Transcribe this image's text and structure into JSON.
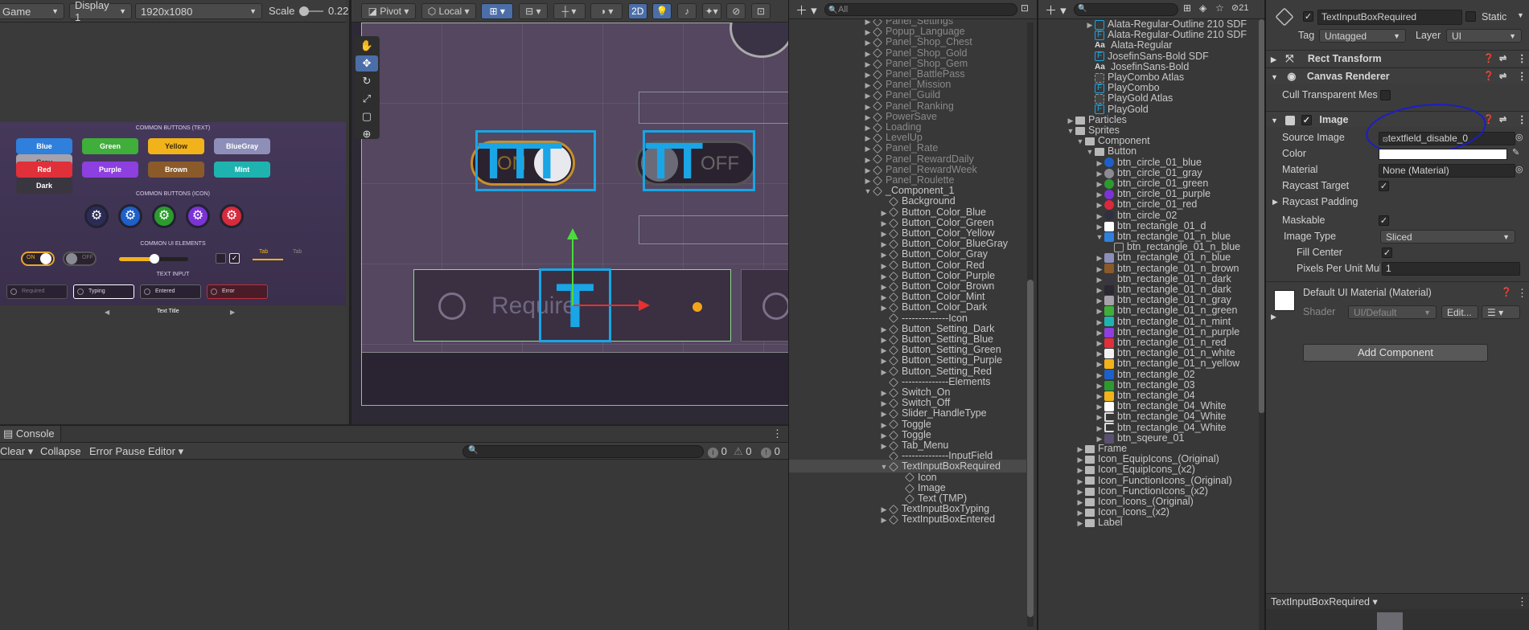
{
  "game_toolbar": {
    "game_label": "Game",
    "display": "Display 1",
    "resolution": "1920x1080",
    "scale_label": "Scale",
    "scale_value": "0.22"
  },
  "scene_toolbar": {
    "pivot": "Pivot",
    "local": "Local",
    "mode_2d": "2D"
  },
  "game_preview": {
    "section_text": "COMMON BUTTONS (TEXT)",
    "buttons_row1": [
      "Blue",
      "Green",
      "Yellow",
      "BlueGray",
      "Gray"
    ],
    "buttons_row2": [
      "Red",
      "Purple",
      "Brown",
      "Mint",
      "Dark"
    ],
    "section_icon": "COMMON BUTTONS (ICON)",
    "section_ui": "COMMON UI ELEMENTS",
    "switch_on": "ON",
    "switch_off": "OFF",
    "tab1": "Tab",
    "tab2": "Tab",
    "section_input": "TEXT INPUT",
    "inputs": [
      "Required",
      "Typing",
      "Entered",
      "Error"
    ],
    "text_title": "Text Title",
    "colors": {
      "Blue": "#2f7fdc",
      "Green": "#3fae3a",
      "Yellow": "#f2b21a",
      "BlueGray": "#8d8fb8",
      "Gray": "#a6a1ab",
      "Red": "#e0303a",
      "Purple": "#8d3fe0",
      "Brown": "#8a5a2a",
      "Mint": "#1fb3b0",
      "Dark": "#3a3640"
    },
    "gear_colors": [
      "#2b2b55",
      "#1f5fc8",
      "#2c9b2e",
      "#7b33d6",
      "#d82a3c"
    ]
  },
  "scene_view": {
    "placeholder_text": "Require",
    "on_label": "ON",
    "off_label": "OFF"
  },
  "console": {
    "tab": "Console",
    "clear": "Clear",
    "collapse": "Collapse",
    "error_pause": "Error Pause",
    "editor": "Editor",
    "count_log": "0",
    "count_warn": "0",
    "count_error": "0"
  },
  "hierarchy": {
    "search_placeholder": "All",
    "items": [
      {
        "label": "Panel_Settings",
        "indent": 0,
        "fold": "▶",
        "dim": true
      },
      {
        "label": "Popup_Language",
        "indent": 0,
        "fold": "▶",
        "dim": true
      },
      {
        "label": "Panel_Shop_Chest",
        "indent": 0,
        "fold": "▶",
        "dim": true
      },
      {
        "label": "Panel_Shop_Gold",
        "indent": 0,
        "fold": "▶",
        "dim": true
      },
      {
        "label": "Panel_Shop_Gem",
        "indent": 0,
        "fold": "▶",
        "dim": true
      },
      {
        "label": "Panel_BattlePass",
        "indent": 0,
        "fold": "▶",
        "dim": true
      },
      {
        "label": "Panel_Mission",
        "indent": 0,
        "fold": "▶",
        "dim": true
      },
      {
        "label": "Panel_Guild",
        "indent": 0,
        "fold": "▶",
        "dim": true
      },
      {
        "label": "Panel_Ranking",
        "indent": 0,
        "fold": "▶",
        "dim": true
      },
      {
        "label": "PowerSave",
        "indent": 0,
        "fold": "▶",
        "dim": true
      },
      {
        "label": "Loading",
        "indent": 0,
        "fold": "▶",
        "dim": true
      },
      {
        "label": "LevelUp",
        "indent": 0,
        "fold": "▶",
        "dim": true
      },
      {
        "label": "Panel_Rate",
        "indent": 0,
        "fold": "▶",
        "dim": true
      },
      {
        "label": "Panel_RewardDaily",
        "indent": 0,
        "fold": "▶",
        "dim": true
      },
      {
        "label": "Panel_RewardWeek",
        "indent": 0,
        "fold": "▶",
        "dim": true
      },
      {
        "label": "Panel_Roulette",
        "indent": 0,
        "fold": "▶",
        "dim": true
      },
      {
        "label": "_Component_1",
        "indent": 0,
        "fold": "▼",
        "dim": false
      },
      {
        "label": "Background",
        "indent": 1,
        "fold": "",
        "dim": false
      },
      {
        "label": "Button_Color_Blue",
        "indent": 1,
        "fold": "▶",
        "dim": false
      },
      {
        "label": "Button_Color_Green",
        "indent": 1,
        "fold": "▶",
        "dim": false
      },
      {
        "label": "Button_Color_Yellow",
        "indent": 1,
        "fold": "▶",
        "dim": false
      },
      {
        "label": "Button_Color_BlueGray",
        "indent": 1,
        "fold": "▶",
        "dim": false
      },
      {
        "label": "Button_Color_Gray",
        "indent": 1,
        "fold": "▶",
        "dim": false
      },
      {
        "label": "Button_Color_Red",
        "indent": 1,
        "fold": "▶",
        "dim": false
      },
      {
        "label": "Button_Color_Purple",
        "indent": 1,
        "fold": "▶",
        "dim": false
      },
      {
        "label": "Button_Color_Brown",
        "indent": 1,
        "fold": "▶",
        "dim": false
      },
      {
        "label": "Button_Color_Mint",
        "indent": 1,
        "fold": "▶",
        "dim": false
      },
      {
        "label": "Button_Color_Dark",
        "indent": 1,
        "fold": "▶",
        "dim": false
      },
      {
        "label": "--------------Icon",
        "indent": 1,
        "fold": "",
        "dim": false
      },
      {
        "label": "Button_Setting_Dark",
        "indent": 1,
        "fold": "▶",
        "dim": false
      },
      {
        "label": "Button_Setting_Blue",
        "indent": 1,
        "fold": "▶",
        "dim": false
      },
      {
        "label": "Button_Setting_Green",
        "indent": 1,
        "fold": "▶",
        "dim": false
      },
      {
        "label": "Button_Setting_Purple",
        "indent": 1,
        "fold": "▶",
        "dim": false
      },
      {
        "label": "Button_Setting_Red",
        "indent": 1,
        "fold": "▶",
        "dim": false
      },
      {
        "label": "--------------Elements",
        "indent": 1,
        "fold": "",
        "dim": false
      },
      {
        "label": "Switch_On",
        "indent": 1,
        "fold": "▶",
        "dim": false
      },
      {
        "label": "Switch_Off",
        "indent": 1,
        "fold": "▶",
        "dim": false
      },
      {
        "label": "Slider_HandleType",
        "indent": 1,
        "fold": "▶",
        "dim": false
      },
      {
        "label": "Toggle",
        "indent": 1,
        "fold": "▶",
        "dim": false
      },
      {
        "label": "Toggle",
        "indent": 1,
        "fold": "▶",
        "dim": false
      },
      {
        "label": "Tab_Menu",
        "indent": 1,
        "fold": "▶",
        "dim": false
      },
      {
        "label": "--------------InputField",
        "indent": 1,
        "fold": "",
        "dim": false
      },
      {
        "label": "TextInputBoxRequired",
        "indent": 1,
        "fold": "▼",
        "dim": false,
        "sel": true
      },
      {
        "label": "Icon",
        "indent": 2,
        "fold": "",
        "dim": false
      },
      {
        "label": "Image",
        "indent": 2,
        "fold": "",
        "dim": false
      },
      {
        "label": "Text (TMP)",
        "indent": 2,
        "fold": "",
        "dim": false
      },
      {
        "label": "TextInputBoxTyping",
        "indent": 1,
        "fold": "▶",
        "dim": false
      },
      {
        "label": "TextInputBoxEntered",
        "indent": 1,
        "fold": "▶",
        "dim": false
      }
    ]
  },
  "project": {
    "count": "21",
    "items": [
      {
        "label": "Alata-Regular-Outline 210 SDF",
        "indent": 2,
        "icon": "font",
        "fold": "▶"
      },
      {
        "label": "Alata-Regular-Outline 210 SDF",
        "indent": 2,
        "icon": "F",
        "fold": ""
      },
      {
        "label": "Alata-Regular",
        "indent": 2,
        "icon": "Aa",
        "fold": ""
      },
      {
        "label": "JosefinSans-Bold SDF",
        "indent": 2,
        "icon": "F",
        "fold": ""
      },
      {
        "label": "JosefinSans-Bold",
        "indent": 2,
        "icon": "Aa",
        "fold": ""
      },
      {
        "label": "PlayCombo Atlas",
        "indent": 2,
        "icon": "atlas",
        "fold": ""
      },
      {
        "label": "PlayCombo",
        "indent": 2,
        "icon": "F",
        "fold": ""
      },
      {
        "label": "PlayGold Atlas",
        "indent": 2,
        "icon": "atlas",
        "fold": ""
      },
      {
        "label": "PlayGold",
        "indent": 2,
        "icon": "F",
        "fold": ""
      },
      {
        "label": "Particles",
        "indent": 0,
        "icon": "folder",
        "fold": "▶"
      },
      {
        "label": "Sprites",
        "indent": 0,
        "icon": "folder",
        "fold": "▼"
      },
      {
        "label": "Component",
        "indent": 1,
        "icon": "folder",
        "fold": "▼"
      },
      {
        "label": "Button",
        "indent": 2,
        "icon": "folder",
        "fold": "▼"
      },
      {
        "label": "btn_circle_01_blue",
        "indent": 3,
        "icon": "#1f5fc8",
        "fold": "▶"
      },
      {
        "label": "btn_circle_01_gray",
        "indent": 3,
        "icon": "#8b8b95",
        "fold": "▶"
      },
      {
        "label": "btn_circle_01_green",
        "indent": 3,
        "icon": "#2c9b2e",
        "fold": "▶"
      },
      {
        "label": "btn_circle_01_purple",
        "indent": 3,
        "icon": "#7b33d6",
        "fold": "▶"
      },
      {
        "label": "btn_circle_01_red",
        "indent": 3,
        "icon": "#d82a3c",
        "fold": "▶"
      },
      {
        "label": "btn_circle_02",
        "indent": 3,
        "icon": "#303040",
        "fold": "▶"
      },
      {
        "label": "btn_rectangle_01_d",
        "indent": 3,
        "icon": "#ffffff",
        "fold": "▶"
      },
      {
        "label": "btn_rectangle_01_n_blue",
        "indent": 3,
        "icon": "#2f7fdc",
        "fold": "▼"
      },
      {
        "label": "btn_rectangle_01_n_blue",
        "indent": 4,
        "icon": "sprite",
        "fold": ""
      },
      {
        "label": "btn_rectangle_01_n_blue",
        "indent": 3,
        "icon": "#8d8fb8",
        "fold": "▶"
      },
      {
        "label": "btn_rectangle_01_n_brown",
        "indent": 3,
        "icon": "#8a5a2a",
        "fold": "▶"
      },
      {
        "label": "btn_rectangle_01_n_dark",
        "indent": 3,
        "icon": "#3a3640",
        "fold": "▶"
      },
      {
        "label": "btn_rectangle_01_n_dark",
        "indent": 3,
        "icon": "#2a2830",
        "fold": "▶"
      },
      {
        "label": "btn_rectangle_01_n_gray",
        "indent": 3,
        "icon": "#a6a1ab",
        "fold": "▶"
      },
      {
        "label": "btn_rectangle_01_n_green",
        "indent": 3,
        "icon": "#3fae3a",
        "fold": "▶"
      },
      {
        "label": "btn_rectangle_01_n_mint",
        "indent": 3,
        "icon": "#1fb3b0",
        "fold": "▶"
      },
      {
        "label": "btn_rectangle_01_n_purple",
        "indent": 3,
        "icon": "#8d3fe0",
        "fold": "▶"
      },
      {
        "label": "btn_rectangle_01_n_red",
        "indent": 3,
        "icon": "#e0303a",
        "fold": "▶"
      },
      {
        "label": "btn_rectangle_01_n_white",
        "indent": 3,
        "icon": "#f2f2f2",
        "fold": "▶"
      },
      {
        "label": "btn_rectangle_01_n_yellow",
        "indent": 3,
        "icon": "#f2b21a",
        "fold": "▶"
      },
      {
        "label": "btn_rectangle_02",
        "indent": 3,
        "icon": "#1f5fc8",
        "fold": "▶"
      },
      {
        "label": "btn_rectangle_03",
        "indent": 3,
        "icon": "#2c9b2e",
        "fold": "▶"
      },
      {
        "label": "btn_rectangle_04",
        "indent": 3,
        "icon": "#f2b21a",
        "fold": "▶"
      },
      {
        "label": "btn_rectangle_04_White",
        "indent": 3,
        "icon": "#ffffff",
        "fold": "▶"
      },
      {
        "label": "btn_rectangle_04_White",
        "indent": 3,
        "icon": "bracket",
        "fold": "▶"
      },
      {
        "label": "btn_rectangle_04_White",
        "indent": 3,
        "icon": "bracket",
        "fold": "▶"
      },
      {
        "label": "btn_sqeure_01",
        "indent": 3,
        "icon": "#5a5070",
        "fold": "▶"
      },
      {
        "label": "Frame",
        "indent": 1,
        "icon": "folder",
        "fold": "▶"
      },
      {
        "label": "Icon_EquipIcons_(Original)",
        "indent": 1,
        "icon": "folder",
        "fold": "▶"
      },
      {
        "label": "Icon_EquipIcons_(x2)",
        "indent": 1,
        "icon": "folder",
        "fold": "▶"
      },
      {
        "label": "Icon_FunctionIcons_(Original)",
        "indent": 1,
        "icon": "folder",
        "fold": "▶"
      },
      {
        "label": "Icon_FunctionIcons_(x2)",
        "indent": 1,
        "icon": "folder",
        "fold": "▶"
      },
      {
        "label": "Icon_Icons_(Original)",
        "indent": 1,
        "icon": "folder",
        "fold": "▶"
      },
      {
        "label": "Icon_Icons_(x2)",
        "indent": 1,
        "icon": "folder",
        "fold": "▶"
      },
      {
        "label": "Label",
        "indent": 1,
        "icon": "folder",
        "fold": "▶"
      }
    ]
  },
  "inspector": {
    "object_name": "TextInputBoxRequired",
    "static_label": "Static",
    "tag_label": "Tag",
    "tag_value": "Untagged",
    "layer_label": "Layer",
    "layer_value": "UI",
    "rect_transform": "Rect Transform",
    "canvas_renderer": "Canvas Renderer",
    "cull_label": "Cull Transparent Mes",
    "image_comp": "Image",
    "source_image_label": "Source Image",
    "source_image_value": "textfield_disable_0",
    "color_label": "Color",
    "material_label": "Material",
    "material_value": "None (Material)",
    "raycast_target_label": "Raycast Target",
    "raycast_padding_label": "Raycast Padding",
    "maskable_label": "Maskable",
    "image_type_label": "Image Type",
    "image_type_value": "Sliced",
    "fill_center_label": "Fill Center",
    "ppu_label": "Pixels Per Unit Mul",
    "ppu_value": "1",
    "material_name": "Default UI Material (Material)",
    "shader_label": "Shader",
    "shader_value": "UI/Default",
    "edit_button": "Edit...",
    "add_component": "Add Component",
    "preview_title": "TextInputBoxRequired"
  }
}
